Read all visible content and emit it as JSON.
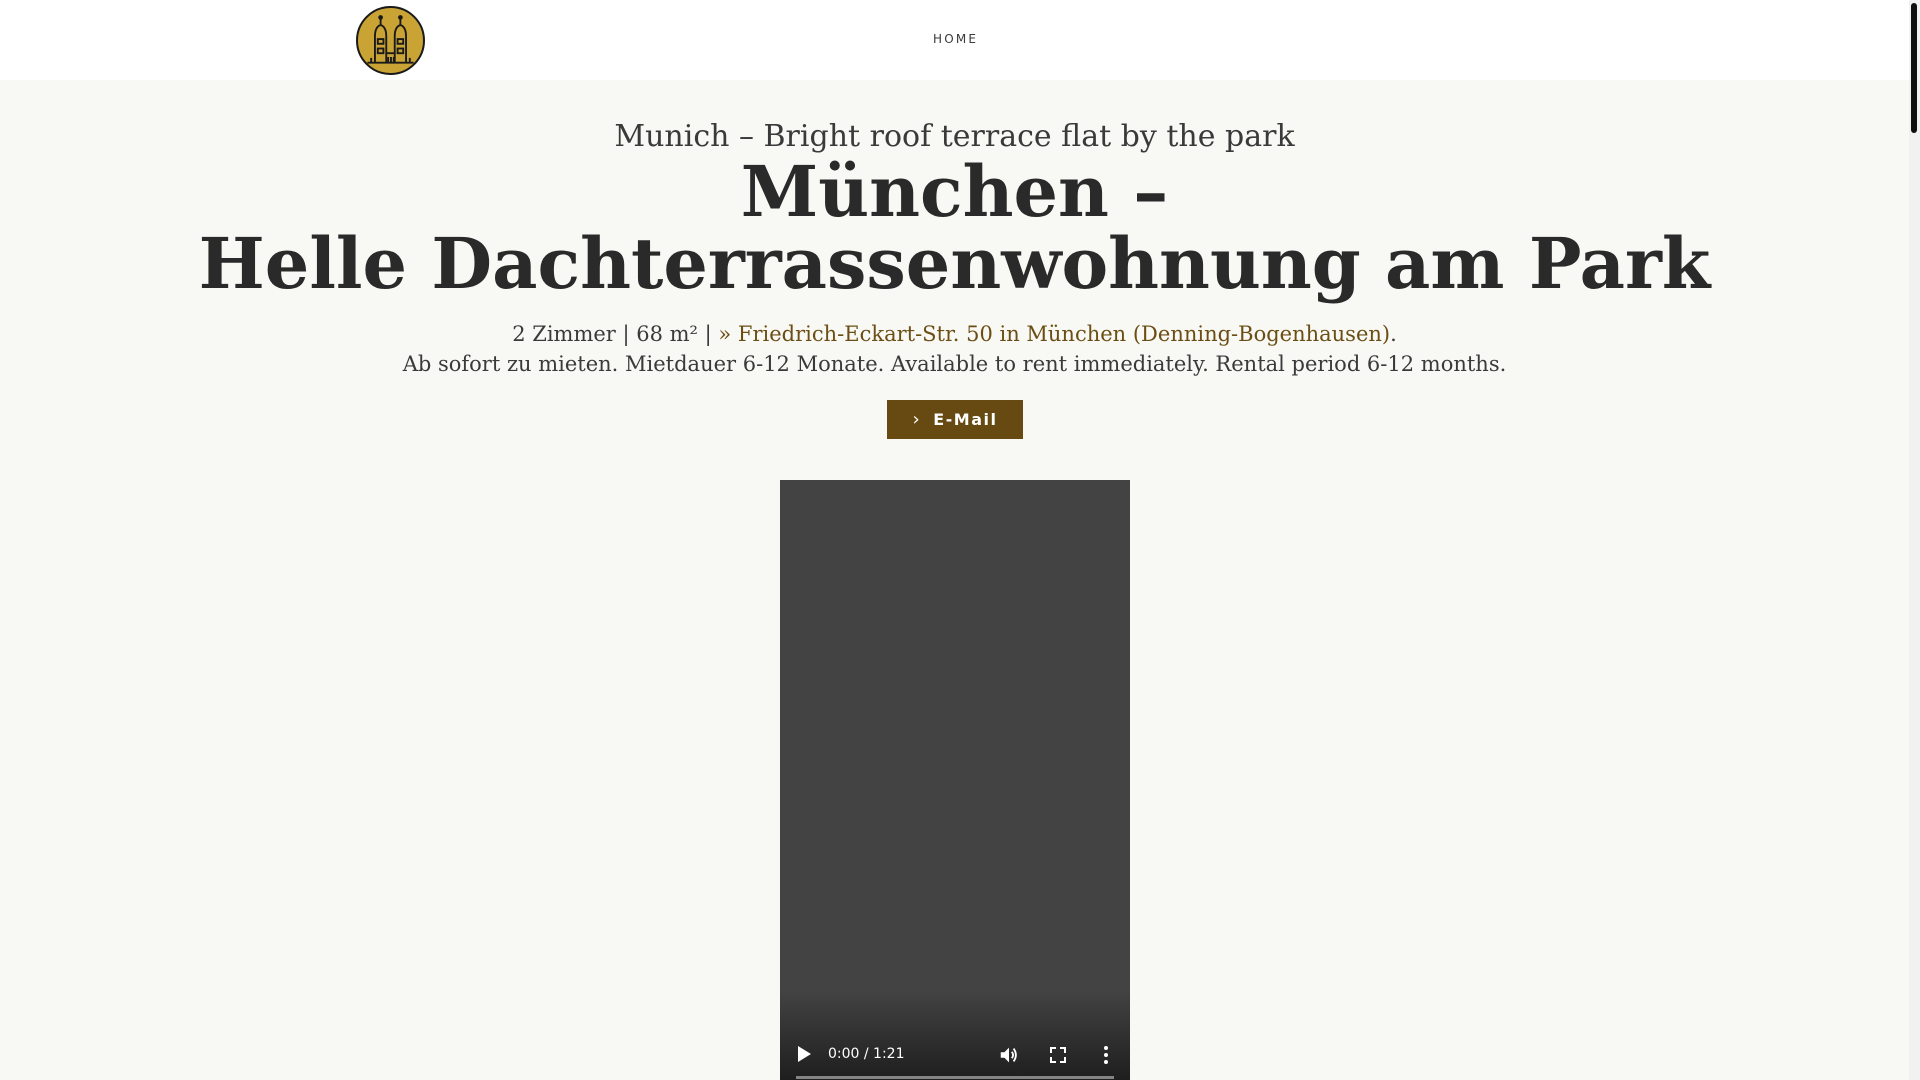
{
  "header": {
    "nav_home": "HOME"
  },
  "icons": {
    "logo": "frauenkirche-towers-logo",
    "button": "chevron-right-icon",
    "play": "play-icon",
    "volume": "volume-icon",
    "fullscreen": "fullscreen-icon",
    "more": "more-vert-icon"
  },
  "colors": {
    "accent": "#664a12",
    "link": "#6b4e14",
    "logo_gold": "#c9a435",
    "background": "#f8f8f4"
  },
  "hero": {
    "subtitle": "Munich – Bright roof terrace flat by the park",
    "title_line1": "München –",
    "title_line2": "Helle Dachterrassenwohnung am Park",
    "info_prefix": "2 Zimmer | 68 m² | ",
    "address_link": "» Friedrich-Eckart-Str. 50 in München (Denning-Bogenhausen)",
    "info_suffix": ".",
    "rent_text": "Ab sofort zu mieten. Mietdauer 6-12 Monate. Available to rent immediately. Rental period 6-12 months.",
    "email_button": "E-Mail"
  },
  "video": {
    "time": "0:00 / 1:21",
    "progress": 0
  }
}
